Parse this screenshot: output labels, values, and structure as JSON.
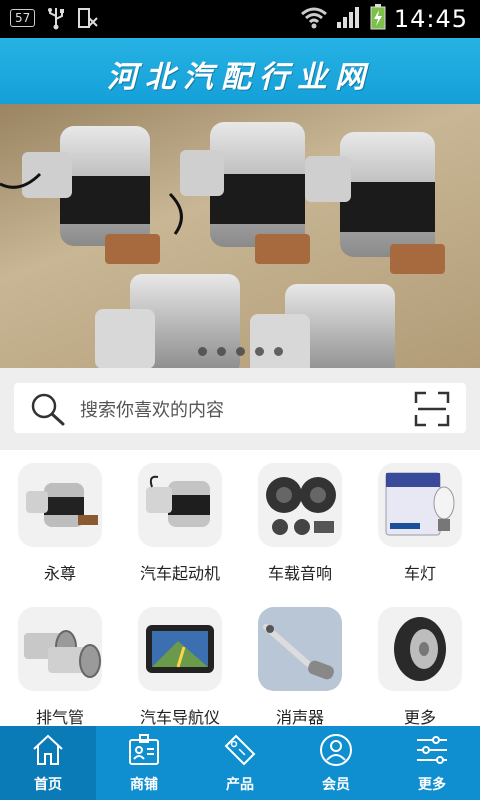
{
  "status_bar": {
    "badge": "57",
    "time": "14:45"
  },
  "header": {
    "title": "河北汽配行业网"
  },
  "banner": {
    "slide_count": 5,
    "active_slide": 1
  },
  "search": {
    "placeholder": "搜索你喜欢的内容"
  },
  "categories": [
    {
      "label": "永尊",
      "icon": "starter-motor-image"
    },
    {
      "label": "汽车起动机",
      "icon": "starter-motor-image"
    },
    {
      "label": "车载音响",
      "icon": "car-speakers-image"
    },
    {
      "label": "车灯",
      "icon": "car-bulb-image"
    },
    {
      "label": "排气管",
      "icon": "exhaust-tips-image"
    },
    {
      "label": "汽车导航仪",
      "icon": "gps-navigator-image"
    },
    {
      "label": "消声器",
      "icon": "muffler-image"
    },
    {
      "label": "更多",
      "icon": "tire-image"
    }
  ],
  "bottom_nav": [
    {
      "label": "首页",
      "icon": "home-icon",
      "active": true
    },
    {
      "label": "商铺",
      "icon": "shop-badge-icon",
      "active": false
    },
    {
      "label": "产品",
      "icon": "sale-tag-icon",
      "active": false
    },
    {
      "label": "会员",
      "icon": "member-icon",
      "active": false
    },
    {
      "label": "更多",
      "icon": "sliders-icon",
      "active": false
    }
  ],
  "colors": {
    "header": "#1aa7dd",
    "nav": "#0f8fd0",
    "nav_active": "#0a7bb7"
  }
}
